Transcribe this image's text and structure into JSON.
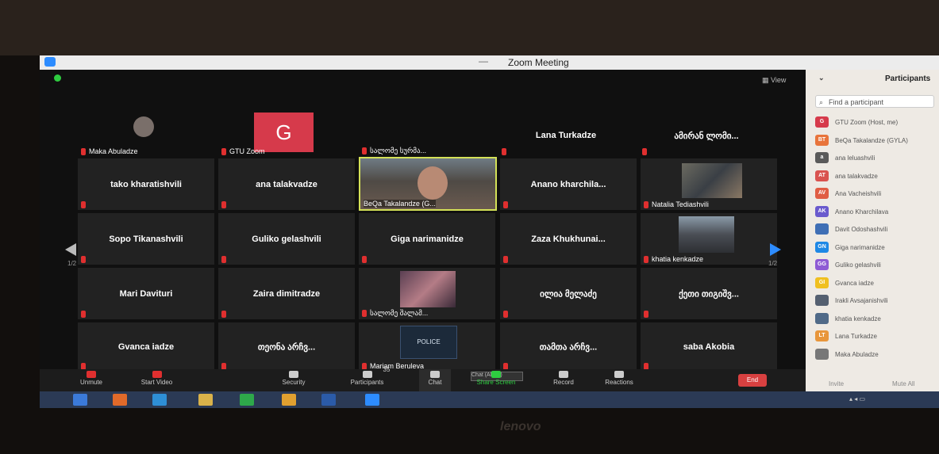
{
  "window": {
    "title": "Zoom Meeting"
  },
  "view_button": "View",
  "grid": {
    "top_row": [
      {
        "label": "Maka Abuladze"
      },
      {
        "label": "GTU Zoom",
        "avatar_letter": "G"
      },
      {
        "label": "სალომე სურმა..."
      },
      {
        "center": "Lana Turkadze"
      },
      {
        "center": "ამირან ლომი..."
      }
    ],
    "rows": [
      [
        "tako kharatishvili",
        "ana talakvadze",
        "",
        "Anano  kharchila...",
        ""
      ],
      [
        "Sopo Tikanashvili",
        "Guliko gelashvili",
        "Giga narimanidze",
        "Zaza  Khukhunai...",
        ""
      ],
      [
        "Mari Davituri",
        "Zaira dimitradze",
        "",
        "ილია მელაძე",
        "ქეთი თიგიშვ..."
      ],
      [
        "Gvanca iadze",
        "თეონა არჩვ...",
        "",
        "თამთა არჩვ...",
        "saba Akobia"
      ]
    ],
    "photo_labels": {
      "speaker": "BeQa Takalandze (G...",
      "natalia": "Natalia Tediashvili",
      "khatia": "khatia kenkadze",
      "salome2": "სალომე შალამ...",
      "mariam": "Mariam Beruleva"
    },
    "police_text": "POLICE",
    "page_left": "1/2",
    "page_right": "1/2"
  },
  "toolbar": {
    "unmute": "Unmute",
    "start_video": "Start Video",
    "security": "Security",
    "participants": "Participants",
    "participants_count": "35",
    "chat": "Chat",
    "share_screen": "Share Screen",
    "record": "Record",
    "reactions": "Reactions",
    "end": "End",
    "chat_tip": "Chat (Alt+H)"
  },
  "participants_panel": {
    "title": "Participants",
    "search_placeholder": "Find a participant",
    "items": [
      {
        "initials": "G",
        "color": "#d63a4b",
        "name": "GTU Zoom (Host, me)"
      },
      {
        "initials": "BT",
        "color": "#e8743b",
        "name": "BeQa Takalandze (GYLA)"
      },
      {
        "initials": "a",
        "color": "#5a5a5a",
        "name": "ana leluashvili"
      },
      {
        "initials": "AT",
        "color": "#d9534f",
        "name": "ana talakvadze"
      },
      {
        "initials": "AV",
        "color": "#e05d44",
        "name": "Ana Vacheishvili"
      },
      {
        "initials": "AK",
        "color": "#6a5acd",
        "name": "Anano Kharchilava"
      },
      {
        "initials": "",
        "color": "#3f6fb5",
        "name": "Davit Odoshashvili"
      },
      {
        "initials": "GN",
        "color": "#1e88e5",
        "name": "Giga narimanidze"
      },
      {
        "initials": "GG",
        "color": "#8e5bd4",
        "name": "Guliko gelashvili"
      },
      {
        "initials": "GI",
        "color": "#f0c020",
        "name": "Gvanca iadze"
      },
      {
        "initials": "",
        "color": "#556070",
        "name": "Irakli Avsajanishvili"
      },
      {
        "initials": "",
        "color": "#506a88",
        "name": "khatia kenkadze"
      },
      {
        "initials": "LT",
        "color": "#e8963b",
        "name": "Lana Turkadze"
      },
      {
        "initials": "",
        "color": "#777",
        "name": "Maka Abuladze"
      }
    ],
    "invite": "Invite",
    "mute_all": "Mute All"
  },
  "bezel_brand": "lenovo"
}
